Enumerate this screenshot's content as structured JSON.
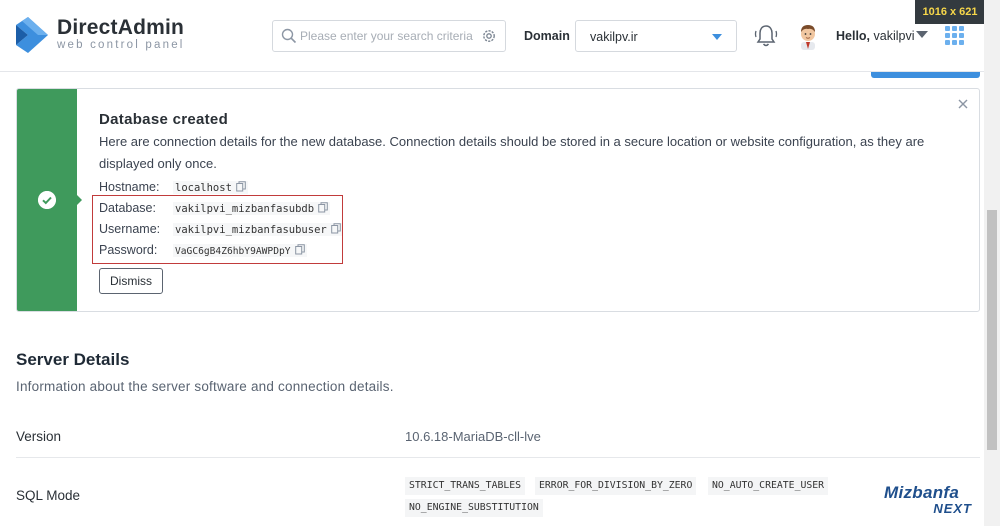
{
  "header": {
    "logo_name": "DirectAdmin",
    "logo_sub": "web control panel",
    "search_placeholder": "Please enter your search criteria",
    "domain_label": "Domain",
    "domain_value": "vakilpv.ir",
    "hello_prefix": "Hello,",
    "user_name": "vakilpvi",
    "size_badge": "1016 x 621"
  },
  "colors": {
    "brand_blue": "#3d8fde",
    "success_green": "#3f9a5c",
    "highlight_red": "#c13b3b"
  },
  "alert": {
    "title": "Database created",
    "description": "Here are connection details for the new database. Connection details should be stored in a secure location or website configuration, as they are displayed only once.",
    "fields": [
      {
        "label": "Hostname:",
        "value": "localhost"
      },
      {
        "label": "Database:",
        "value": "vakilpvi_mizbanfasubdb"
      },
      {
        "label": "Username:",
        "value": "vakilpvi_mizbanfasubuser"
      },
      {
        "label": "Password:",
        "value": "VaGC6gB4Z6hbY9AWPDpY"
      }
    ],
    "dismiss_label": "Dismiss"
  },
  "server_details": {
    "title": "Server Details",
    "subtitle": "Information about the server software and connection details.",
    "version_label": "Version",
    "version_value": "10.6.18-MariaDB-cll-lve",
    "sql_mode_label": "SQL Mode",
    "sql_mode_tags": [
      "STRICT_TRANS_TABLES",
      "ERROR_FOR_DIVISION_BY_ZERO",
      "NO_AUTO_CREATE_USER",
      "NO_ENGINE_SUBSTITUTION"
    ]
  },
  "watermark": {
    "top": "Mizbanfa",
    "bottom": "NEXT"
  },
  "icons": [
    "directadmin-logo-icon",
    "search-icon",
    "gear-icon",
    "chevron-down-icon",
    "bell-icon",
    "avatar-icon",
    "apps-grid-icon",
    "close-icon",
    "check-icon",
    "copy-icon"
  ]
}
